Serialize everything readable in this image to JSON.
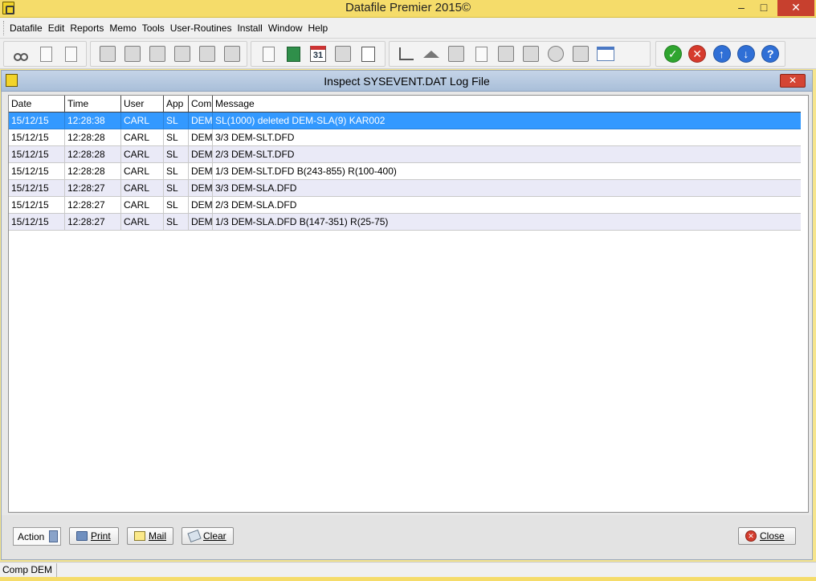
{
  "app": {
    "title": "Datafile  Premier 2015©",
    "window_controls": {
      "minimize": "–",
      "maximize": "□",
      "close": "✕"
    }
  },
  "menu": [
    "Datafile",
    "Edit",
    "Reports",
    "Memo",
    "Tools",
    "User-Routines",
    "Install",
    "Window",
    "Help"
  ],
  "toolbar": {
    "group1": [
      "cut-icon",
      "new-document-icon",
      "document-info-icon"
    ],
    "group2": [
      "find-record-icon",
      "add-record-icon",
      "delete-record-icon",
      "open-box-icon",
      "record-info-icon",
      "eraser-icon"
    ],
    "group3": [
      "new-file-icon",
      "calculator-icon",
      "calendar-icon",
      "search-file-icon",
      "checklist-icon"
    ],
    "group4": [
      "chart-icon",
      "home-icon",
      "mail-send-icon",
      "word-export-icon",
      "picture-icon",
      "screen-add-icon",
      "network-icon",
      "printer-icon",
      "window-export-icon"
    ],
    "group5": [
      "ok-icon",
      "cancel-icon",
      "up-icon",
      "down-icon",
      "help-icon"
    ],
    "calendar_day": "31"
  },
  "dialog": {
    "title": "Inspect SYSEVENT.DAT Log File",
    "close_label": "✕"
  },
  "grid": {
    "columns": [
      "Date",
      "Time",
      "User",
      "App",
      "Com",
      "Message"
    ],
    "rows": [
      [
        "15/12/15",
        "12:28:38",
        "CARL",
        "SL",
        "DEM",
        "SL(1000) deleted DEM-SLA(9) KAR002"
      ],
      [
        "15/12/15",
        "12:28:28",
        "CARL",
        "SL",
        "DEM",
        "3/3 DEM-SLT.DFD"
      ],
      [
        "15/12/15",
        "12:28:28",
        "CARL",
        "SL",
        "DEM",
        "2/3 DEM-SLT.DFD"
      ],
      [
        "15/12/15",
        "12:28:28",
        "CARL",
        "SL",
        "DEM",
        "1/3 DEM-SLT.DFD B(243-855) R(100-400)"
      ],
      [
        "15/12/15",
        "12:28:27",
        "CARL",
        "SL",
        "DEM",
        "3/3 DEM-SLA.DFD"
      ],
      [
        "15/12/15",
        "12:28:27",
        "CARL",
        "SL",
        "DEM",
        "2/3 DEM-SLA.DFD"
      ],
      [
        "15/12/15",
        "12:28:27",
        "CARL",
        "SL",
        "DEM",
        "1/3 DEM-SLA.DFD B(147-351) R(25-75)"
      ]
    ],
    "selected_row": 0
  },
  "actions": {
    "action_label": "Action",
    "print_label": "Print",
    "mail_label": "Mail",
    "clear_label": "Clear",
    "close_label": "Close"
  },
  "status": {
    "company": "Comp DEM"
  },
  "colors": {
    "title_bar": "#f5dc6a",
    "selection": "#3399ff",
    "alt_row": "#eaeaf7",
    "close_red": "#c7402e"
  }
}
